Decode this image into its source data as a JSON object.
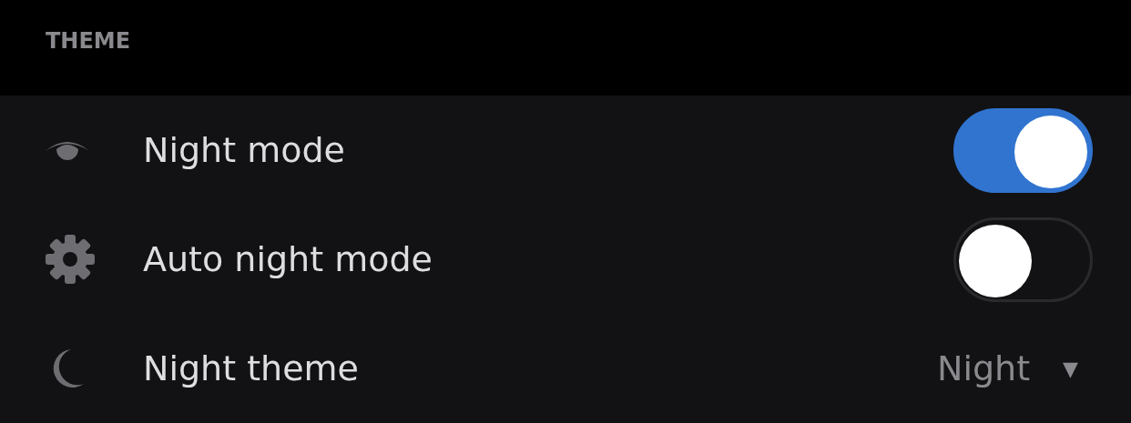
{
  "section": {
    "title": "THEME"
  },
  "settings": [
    {
      "kind": "toggle",
      "label": "Night mode",
      "on": true
    },
    {
      "kind": "toggle",
      "label": "Auto night mode",
      "on": false
    },
    {
      "kind": "dropdown",
      "label": "Night theme",
      "value": "Night",
      "caret": "▼"
    }
  ]
}
